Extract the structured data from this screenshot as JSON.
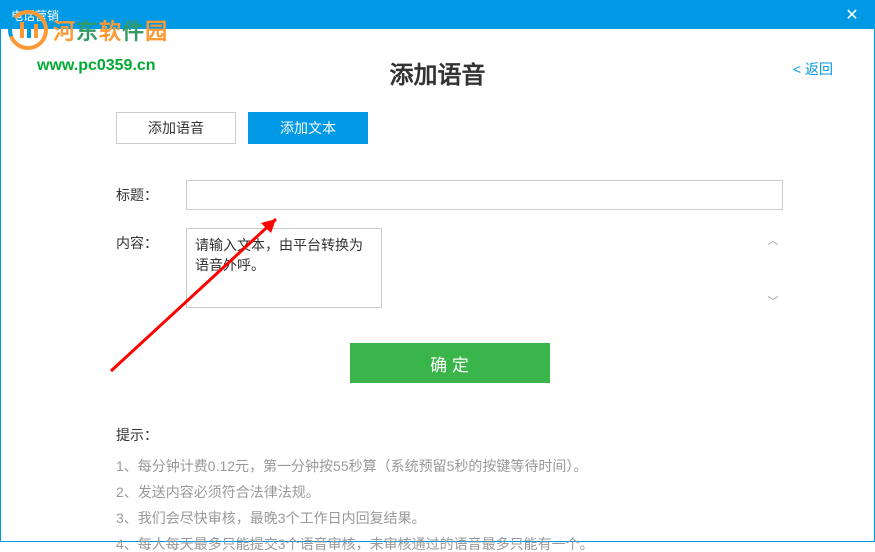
{
  "window": {
    "title": "电话营销"
  },
  "watermark": {
    "text1": "河东软件园",
    "url": "www.pc0359.cn"
  },
  "header": {
    "title": "添加语音",
    "back": "< 返回"
  },
  "tabs": {
    "add_voice": "添加语音",
    "add_text": "添加文本"
  },
  "form": {
    "title_label": "标题：",
    "content_label": "内容：",
    "content_placeholder": "请输入文本，由平台转换为语音外呼。",
    "confirm": "确 定"
  },
  "tips": {
    "heading": "提示：",
    "items": [
      "1、每分钟计费0.12元，第一分钟按55秒算（系统预留5秒的按键等待时间）。",
      "2、发送内容必须符合法律法规。",
      "3、我们会尽快审核，最晚3个工作日内回复结果。",
      "4、每人每天最多只能提交3个语音审核，未审核通过的语音最多只能有一个。"
    ]
  }
}
